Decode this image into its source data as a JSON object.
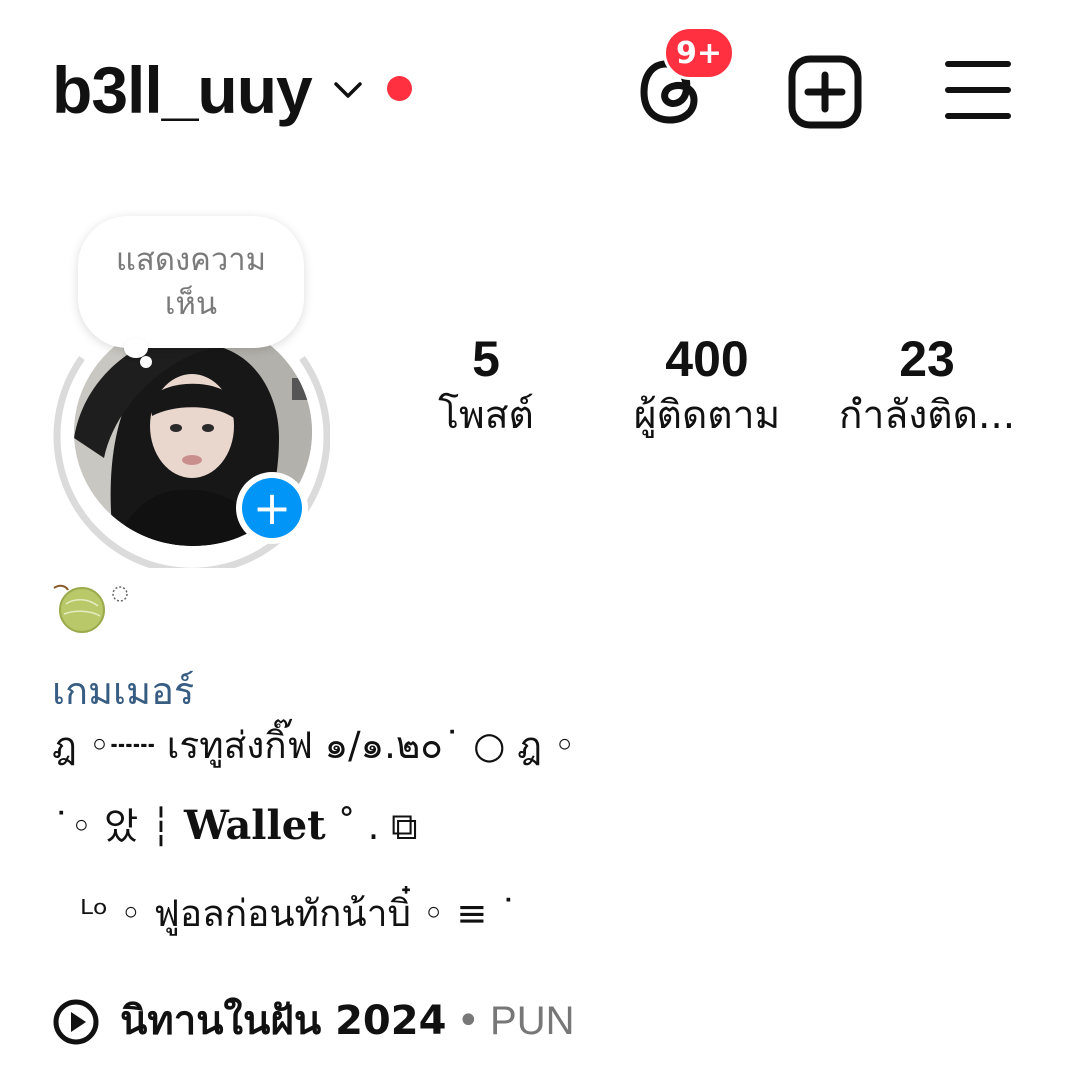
{
  "header": {
    "username": "b3ll_uuy",
    "notification_badge": "9+"
  },
  "note": {
    "text": "แสดงความเห็น"
  },
  "stats": {
    "posts": {
      "count": "5",
      "label": "โพสต์"
    },
    "followers": {
      "count": "400",
      "label": "ผู้ติดตาม"
    },
    "following": {
      "count": "23",
      "label": "กำลังติด..."
    }
  },
  "profile": {
    "melon_emoji": "🍈ิ",
    "category": "เกมเมอร์",
    "bio_lines": [
      "ฎ  ◦┄┄   เรทูส่งกิ๊ฟ ๑/๑.๒๐˙  ○ ฎ  ◦",
      "˙◦ 았 ┆ Wallet ˚ . ⧉",
      " ᴸᵒ ◦ ฟูอลก่อนทักน้าบิ๋    ◦ ≡ ˙"
    ],
    "bio_wallet_word": "Wallet"
  },
  "music": {
    "title": "นิทานในฝัน 2024",
    "separator": "•",
    "artist": "PUN"
  },
  "colors": {
    "red": "#ff3040",
    "blue": "#0095f6",
    "category": "#385d82",
    "ring": "#dbdbdb"
  },
  "icons": {
    "threads": "threads-icon",
    "create": "plus-square-icon",
    "menu": "hamburger-menu-icon",
    "chevron": "chevron-down-icon",
    "add_story": "plus-icon",
    "music": "play-circle-icon"
  }
}
